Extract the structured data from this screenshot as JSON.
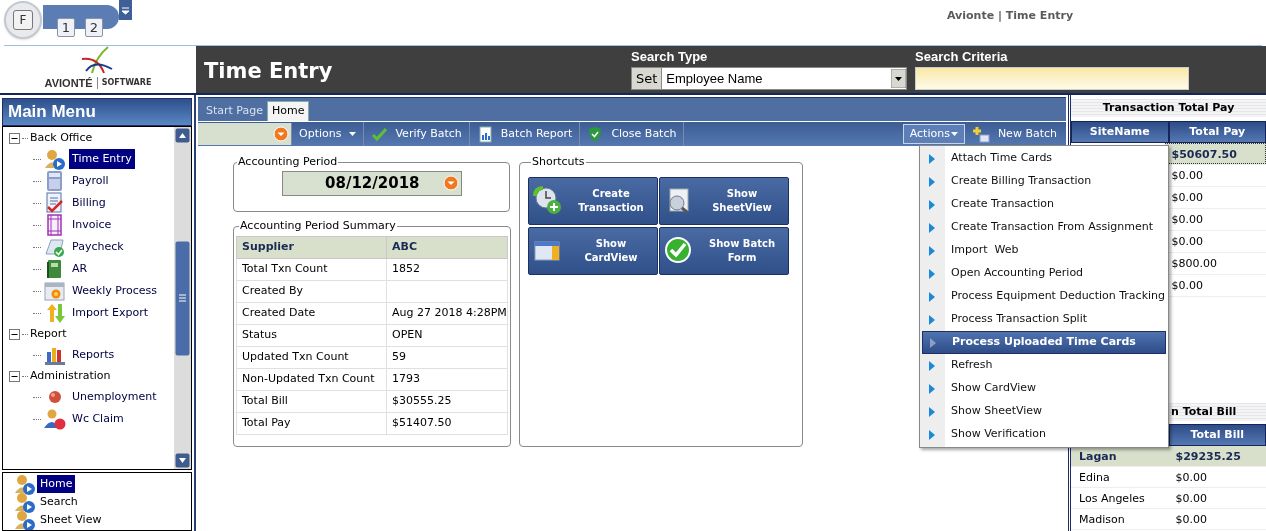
{
  "quick_access": {
    "app_button": "F",
    "badges": [
      "1",
      "2"
    ]
  },
  "window": {
    "title": "Avionte | Time Entry"
  },
  "header": {
    "logo_text": "AVIONTÉ",
    "logo_sub": "SOFTWARE",
    "page_title": "Time Entry",
    "search_type": {
      "label": "Search Type",
      "button": "Set",
      "value": "Employee Name"
    },
    "search_criteria": {
      "label": "Search Criteria"
    }
  },
  "main_menu": {
    "title": "Main Menu",
    "tree": [
      {
        "label": "Back Office",
        "expanded": true,
        "children": [
          {
            "label": "Time Entry",
            "selected": true
          },
          {
            "label": "Payroll",
            "selected": false
          },
          {
            "label": "Billing",
            "selected": false
          },
          {
            "label": "Invoice",
            "selected": false
          },
          {
            "label": "Paycheck",
            "selected": false
          },
          {
            "label": "AR",
            "selected": false
          },
          {
            "label": "Weekly Process",
            "selected": false
          },
          {
            "label": "Import Export",
            "selected": false
          }
        ]
      },
      {
        "label": "Report",
        "expanded": true,
        "children": [
          {
            "label": "Reports",
            "selected": false
          }
        ]
      },
      {
        "label": "Administration",
        "expanded": true,
        "children": [
          {
            "label": "Unemployment",
            "selected": false
          },
          {
            "label": "Wc Claim",
            "selected": false
          }
        ]
      }
    ]
  },
  "quick_links": [
    {
      "label": "Home",
      "selected": true
    },
    {
      "label": "Search",
      "selected": false
    },
    {
      "label": "Sheet View",
      "selected": false
    }
  ],
  "tabs": [
    {
      "label": "Start Page",
      "selected": false
    },
    {
      "label": "Home",
      "selected": true
    }
  ],
  "toolbar": {
    "buttons": [
      "Options",
      "Verify Batch",
      "Batch Report",
      "Close Batch"
    ],
    "actions": "Actions",
    "new_batch": "New Batch"
  },
  "actions_menu": {
    "expanded": true,
    "items": [
      {
        "label": "Attach Time Cards",
        "selected": false
      },
      {
        "label": "Create Billing Transaction",
        "selected": false
      },
      {
        "label": "Create Transaction",
        "selected": false
      },
      {
        "label": "Create Transaction From Assignment",
        "selected": false
      },
      {
        "label": "Import  Web",
        "selected": false
      },
      {
        "label": "Open Accounting Period",
        "selected": false
      },
      {
        "label": "Process Equipment Deduction Tracking",
        "selected": false
      },
      {
        "label": "Process Transaction Split",
        "selected": false
      },
      {
        "label": "Process Uploaded Time Cards",
        "selected": true
      },
      {
        "label": "Refresh",
        "selected": false
      },
      {
        "label": "Show CardView",
        "selected": false
      },
      {
        "label": "Show SheetView",
        "selected": false
      },
      {
        "label": "Show Verification",
        "selected": false
      }
    ]
  },
  "accounting_period": {
    "title": "Accounting Period",
    "date": "08/12/2018"
  },
  "summary": {
    "title": "Accounting Period Summary",
    "columns": [
      "Supplier",
      "ABC"
    ],
    "rows": [
      [
        "Total Txn Count",
        "1852"
      ],
      [
        "Created By",
        null
      ],
      [
        "Created Date",
        "Aug 27 2018  4:28PM"
      ],
      [
        "Status",
        "OPEN"
      ],
      [
        "Updated Txn Count",
        "59"
      ],
      [
        "Non-Updated Txn Count",
        "1793"
      ],
      [
        "Total Bill",
        "$30555.25"
      ],
      [
        "Total Pay",
        "$51407.50"
      ]
    ]
  },
  "shortcuts": {
    "title": "Shortcuts",
    "buttons": [
      "Create Transaction",
      "Show SheetView",
      "Show CardView",
      "Show Batch Form"
    ]
  },
  "total_pay": {
    "title": "Transaction Total Pay",
    "columns": [
      "SiteName",
      "Total Pay"
    ],
    "rows": [
      {
        "total_pay": "$50607.50",
        "selected": true
      },
      {
        "total_pay": "$0.00",
        "selected": false
      },
      {
        "total_pay": "$0.00",
        "selected": false
      },
      {
        "total_pay": "$0.00",
        "selected": false
      },
      {
        "total_pay": "$0.00",
        "selected": false
      },
      {
        "total_pay": "$800.00",
        "selected": false
      },
      {
        "total_pay": "$0.00",
        "selected": false
      }
    ]
  },
  "total_bill": {
    "title": "n Total Bill",
    "columns": [
      "Total Bill"
    ],
    "rows": [
      {
        "site_name": "Lagan",
        "total_bill": "$29235.25",
        "selected": true
      },
      {
        "site_name": "Edina",
        "total_bill": "$0.00",
        "selected": false
      },
      {
        "site_name": "Los Angeles",
        "total_bill": "$0.00",
        "selected": false
      },
      {
        "site_name": "Madison",
        "total_bill": "$0.00",
        "selected": false
      }
    ]
  }
}
